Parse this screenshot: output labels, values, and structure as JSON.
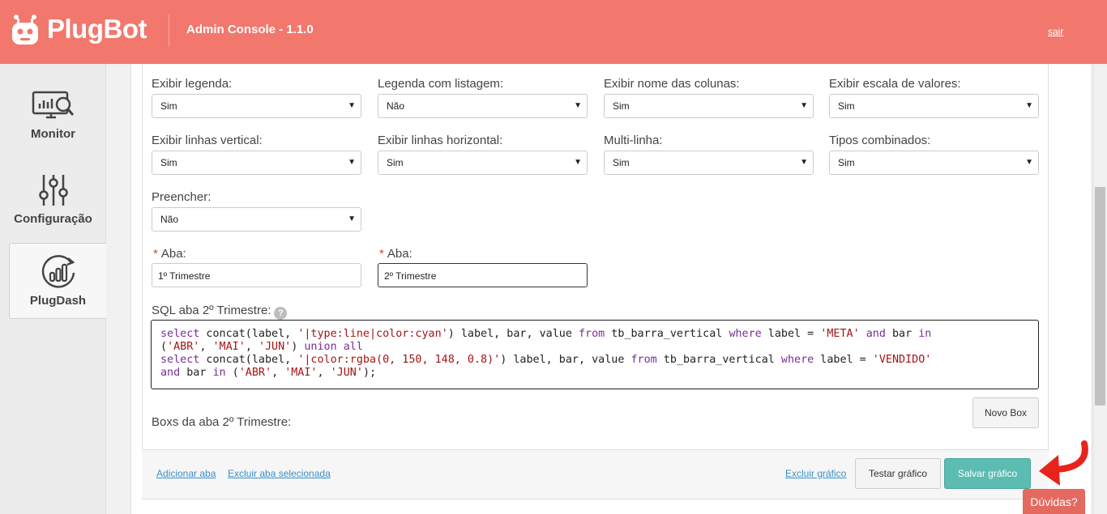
{
  "header": {
    "brand": "PlugBot",
    "app_title": "Admin Console - 1.1.0",
    "logout": "sair",
    "color": "#f2776d",
    "logo_icon": "robot-icon"
  },
  "sidebar": {
    "items": [
      {
        "label": "Monitor",
        "icon": "monitor-search-icon"
      },
      {
        "label": "Configuração",
        "icon": "sliders-icon"
      },
      {
        "label": "PlugDash",
        "icon": "chart-refresh-icon",
        "active": true
      }
    ]
  },
  "form": {
    "labels": {
      "exibir_legenda": "Exibir legenda:",
      "legenda_listagem": "Legenda com listagem:",
      "exibir_nome_colunas": "Exibir nome das colunas:",
      "exibir_escala": "Exibir escala de valores:",
      "linhas_vertical": "Exibir linhas vertical:",
      "linhas_horizontal": "Exibir linhas horizontal:",
      "multi_linha": "Multi-linha:",
      "tipos_combinados": "Tipos combinados:",
      "preencher": "Preencher:",
      "aba1": "Aba:",
      "aba2": "Aba:",
      "sql": "SQL aba 2º Trimestre:",
      "boxs": "Boxs da aba 2º Trimestre:"
    },
    "values": {
      "exibir_legenda": "Sim",
      "legenda_listagem": "Não",
      "exibir_nome_colunas": "Sim",
      "exibir_escala": "Sim",
      "linhas_vertical": "Sim",
      "linhas_horizontal": "Sim",
      "multi_linha": "Sim",
      "tipos_combinados": "Sim",
      "preencher": "Não",
      "aba1": "1º Trimestre",
      "aba2": "2º Trimestre"
    },
    "required_mark": "*",
    "help_glyph": "?",
    "caret": "▼"
  },
  "sql": {
    "l1a": "select",
    "l1b": " concat(label, ",
    "l1c": "'|type:line|color:cyan'",
    "l1d": ") label, bar, value ",
    "l1e": "from",
    "l1f": " tb_barra_vertical ",
    "l1g": "where",
    "l1h": " label = ",
    "l1i": "'META'",
    "l1j": " ",
    "l1k": "and",
    "l1l": " bar ",
    "l1m": "in",
    "l2a": "(",
    "l2b": "'ABR'",
    "l2c": ", ",
    "l2d": "'MAI'",
    "l2e": ", ",
    "l2f": "'JUN'",
    "l2g": ") ",
    "l2h": "union all",
    "l3a": "select",
    "l3b": " concat(label, ",
    "l3c": "'|color:rgba(0, 150, 148, 0.8)'",
    "l3d": ") label, bar, value ",
    "l3e": "from",
    "l3f": " tb_barra_vertical ",
    "l3g": "where",
    "l3h": " label = ",
    "l3i": "'VENDIDO'",
    "l4a": "and",
    "l4b": " bar ",
    "l4c": "in",
    "l4d": " (",
    "l4e": "'ABR'",
    "l4f": ", ",
    "l4g": "'MAI'",
    "l4h": ", ",
    "l4i": "'JUN'",
    "l4j": ");"
  },
  "buttons": {
    "novo_box": "Novo Box",
    "testar": "Testar gráfico",
    "salvar": "Salvar gráfico",
    "adicionar_aba": "Adicionar aba",
    "excluir_aba": "Excluir aba selecionada",
    "excluir_grafico": "Excluir gráfico",
    "duvidas": "Dúvidas?"
  }
}
